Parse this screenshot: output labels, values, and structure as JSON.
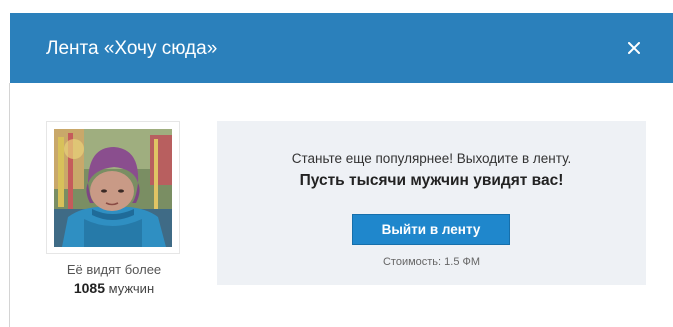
{
  "dialog": {
    "title": "Лента «Хочу сюда»",
    "close_icon": "close-icon"
  },
  "profile": {
    "photo_alt": "profile-photo",
    "stats_prefix": "Её видят более",
    "viewer_count": "1085",
    "viewer_suffix": " мужчин"
  },
  "promo": {
    "line1": "Станьте еще популярнее! Выходите в ленту.",
    "line2": "Пусть тысячи мужчин увидят вас!",
    "button_label": "Выйти в ленту",
    "cost": "Стоимость: 1.5 ФМ"
  },
  "colors": {
    "header_bg": "#2b80bb",
    "button_bg": "#1f87cc",
    "promo_bg": "#eef1f5"
  }
}
